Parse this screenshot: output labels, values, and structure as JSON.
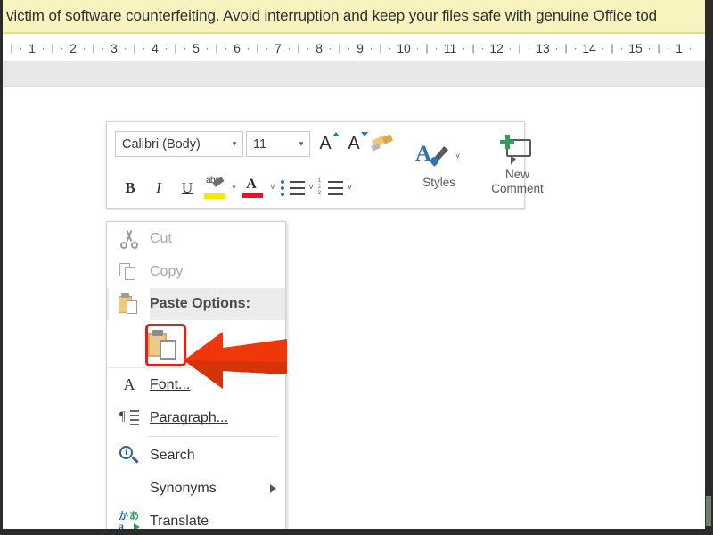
{
  "banner": {
    "text": "victim of software counterfeiting. Avoid interruption and keep your files safe with genuine Office tod",
    "bg_color": "#f8f4c0"
  },
  "ruler": {
    "marks": [
      "1",
      "2",
      "3",
      "4",
      "5",
      "6",
      "7",
      "8",
      "9",
      "10",
      "11",
      "12",
      "13",
      "14",
      "15",
      "1"
    ],
    "pipe": "|",
    "dot": "·"
  },
  "mini_toolbar": {
    "font_name": "Calibri (Body)",
    "font_size": "11",
    "dropdown_caret": "▾",
    "buttons": {
      "grow_font": "A",
      "shrink_font": "A",
      "format_painter": "format-painter",
      "bold": "B",
      "italic": "I",
      "underline": "U",
      "highlight": "abc",
      "font_color": "A",
      "bullets": "bullets",
      "numbering": "numbering"
    },
    "styles_label": "Styles",
    "new_comment_line1": "New",
    "new_comment_line2": "Comment",
    "caret_small": "˅"
  },
  "context_menu": {
    "items": [
      {
        "id": "cut",
        "label": "Cut",
        "icon": "scissors-icon",
        "disabled": true,
        "submenu": false
      },
      {
        "id": "copy",
        "label": "Copy",
        "icon": "copy-icon",
        "disabled": true,
        "submenu": false
      },
      {
        "id": "paste_hdr",
        "label": "Paste Options:",
        "icon": "clipboard-icon",
        "disabled": false,
        "submenu": false
      },
      {
        "id": "font",
        "label": "Font...",
        "icon": "font-a-icon",
        "disabled": false,
        "submenu": false
      },
      {
        "id": "paragraph",
        "label": "Paragraph...",
        "icon": "paragraph-icon",
        "disabled": false,
        "submenu": false
      },
      {
        "id": "search",
        "label": "Search",
        "icon": "search-icon",
        "disabled": false,
        "submenu": false
      },
      {
        "id": "synonyms",
        "label": "Synonyms",
        "icon": "none",
        "disabled": false,
        "submenu": true
      },
      {
        "id": "translate",
        "label": "Translate",
        "icon": "translate-icon",
        "disabled": false,
        "submenu": false
      }
    ],
    "paste_option_icon": "keep-source-formatting-icon"
  },
  "annotation": {
    "highlight_color": "#ee1c10",
    "arrow_color": "#f0360b",
    "arrow_shade_color": "#c92a06"
  },
  "colors": {
    "banner_bg": "#f8f4c0",
    "gray_band": "#e8e8e8",
    "frame": "#2b2b2b",
    "menu_header_bg": "#ebebeb",
    "accent_blue": "#2e75b6",
    "highlight_yellow": "#ffe600",
    "font_color_red": "#e8112d",
    "clipboard_tan": "#efc983",
    "green": "#2e9e5b"
  }
}
